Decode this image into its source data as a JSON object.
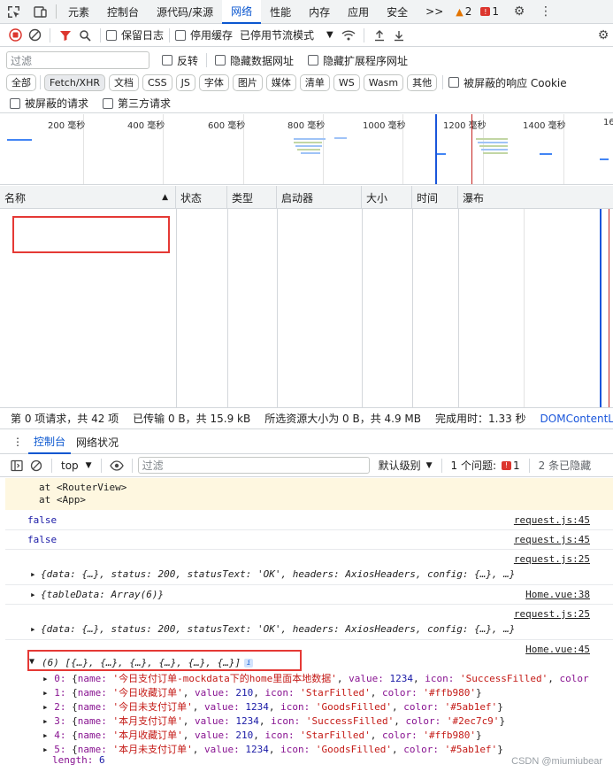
{
  "tabbar": {
    "tabs": [
      "元素",
      "控制台",
      "源代码/来源",
      "网络",
      "性能",
      "内存",
      "应用",
      "安全"
    ],
    "active": "网络",
    "more": ">>",
    "warnings": "2",
    "errors": "1"
  },
  "toolbar": {
    "preserve_log": "保留日志",
    "disable_cache": "停用缓存",
    "throttle": "已停用节流模式"
  },
  "filter": {
    "placeholder": "过滤",
    "invert": "反转",
    "hide_data_urls": "隐藏数据网址",
    "hide_ext_urls": "隐藏扩展程序网址"
  },
  "types": [
    "全部",
    "Fetch/XHR",
    "文档",
    "CSS",
    "JS",
    "字体",
    "图片",
    "媒体",
    "清单",
    "WS",
    "Wasm",
    "其他"
  ],
  "active_type": "Fetch/XHR",
  "blocked_response_cookie": "被屏蔽的响应 Cookie",
  "blocked_requests": "被屏蔽的请求",
  "third_party": "第三方请求",
  "overview": {
    "ticks": [
      "200 毫秒",
      "400 毫秒",
      "600 毫秒",
      "800 毫秒",
      "1000 毫秒",
      "1200 毫秒",
      "1400 毫秒",
      "16"
    ]
  },
  "table": {
    "columns": [
      "名称",
      "状态",
      "类型",
      "启动器",
      "大小",
      "时间",
      "瀑布"
    ]
  },
  "status": {
    "requests": "第 0 项请求，共 42 项",
    "transferred": "已传输 0 B，共 15.9 kB",
    "resources": "所选资源大小为 0 B，共 4.9 MB",
    "finish": "完成用时：1.33 秒",
    "dcl": "DOMContentLoade"
  },
  "drawer": {
    "tabs": [
      "控制台",
      "网络状况"
    ]
  },
  "console_toolbar": {
    "context": "top",
    "filter_placeholder": "过滤",
    "level": "默认级别",
    "issues_label": "1 个问题:",
    "issues_count": "1",
    "hidden": "2 条已隐藏"
  },
  "console": {
    "warn_lines": [
      "at <RouterView>",
      "at <App>"
    ],
    "lines": [
      {
        "text": "false",
        "src": "request.js:45"
      },
      {
        "text": "false",
        "src": "request.js:45"
      },
      {
        "text": "",
        "src": "request.js:25"
      },
      {
        "text": "{data: {…}, status: 200, statusText: 'OK', headers: AxiosHeaders, config: {…}, …}",
        "src": ""
      },
      {
        "text": "{tableData: Array(6)}",
        "src": "Home.vue:38"
      },
      {
        "text": "",
        "src": "request.js:25"
      },
      {
        "text": "{data: {…}, status: 200, statusText: 'OK', headers: AxiosHeaders, config: {…}, …}",
        "src": ""
      },
      {
        "text": "",
        "src": "Home.vue:45"
      },
      {
        "text": "(6) [{…}, {…}, {…}, {…}, {…}, {…}]",
        "src": ""
      }
    ],
    "array_items": [
      {
        "index": "0",
        "name": "今日支付订单-mockdata下的home里面本地数据",
        "value": "1234",
        "icon": "SuccessFilled",
        "color": ""
      },
      {
        "index": "1",
        "name": "今日收藏订单",
        "value": "210",
        "icon": "StarFilled",
        "color": "#ffb980"
      },
      {
        "index": "2",
        "name": "今日未支付订单",
        "value": "1234",
        "icon": "GoodsFilled",
        "color": "#5ab1ef"
      },
      {
        "index": "3",
        "name": "本月支付订单",
        "value": "1234",
        "icon": "SuccessFilled",
        "color": "#2ec7c9"
      },
      {
        "index": "4",
        "name": "本月收藏订单",
        "value": "210",
        "icon": "StarFilled",
        "color": "#ffb980"
      },
      {
        "index": "5",
        "name": "本月未支付订单",
        "value": "1234",
        "icon": "GoodsFilled",
        "color": "#5ab1ef"
      }
    ],
    "length": "6"
  },
  "watermark": "CSDN @miumiubear"
}
